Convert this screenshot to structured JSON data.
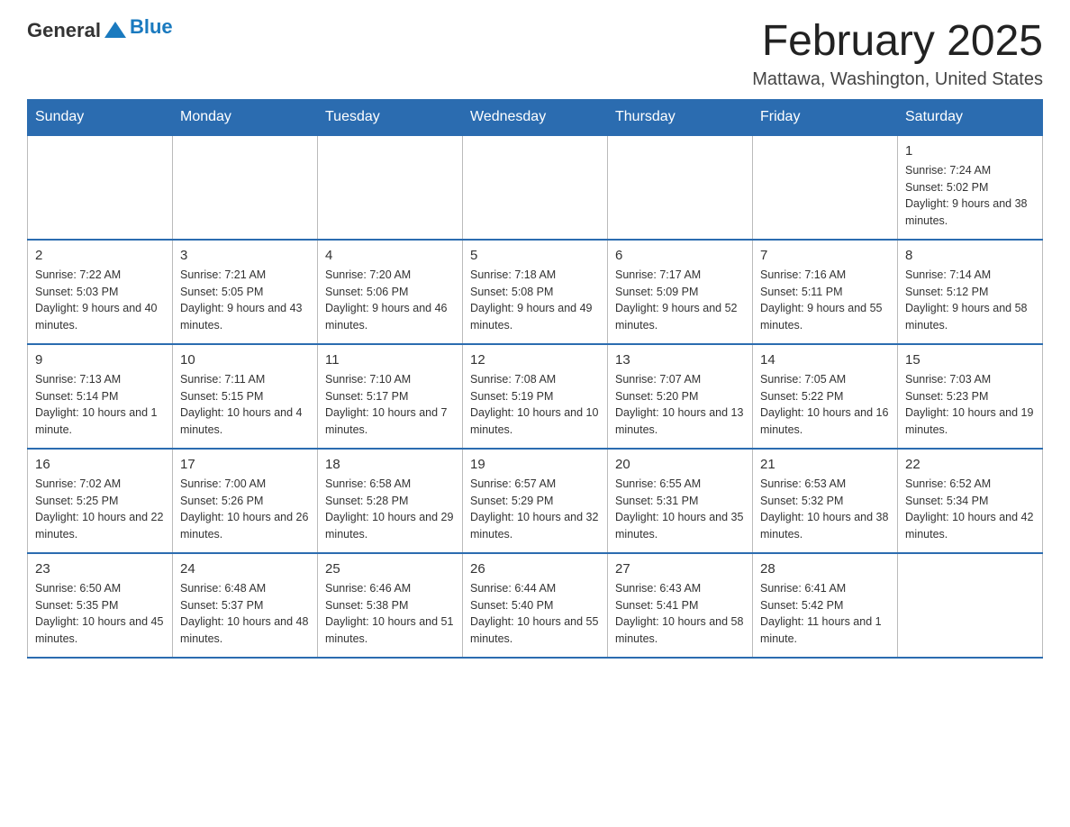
{
  "header": {
    "logo": {
      "general": "General",
      "blue": "Blue"
    },
    "title": "February 2025",
    "location": "Mattawa, Washington, United States"
  },
  "weekdays": [
    "Sunday",
    "Monday",
    "Tuesday",
    "Wednesday",
    "Thursday",
    "Friday",
    "Saturday"
  ],
  "weeks": [
    [
      {
        "day": "",
        "info": ""
      },
      {
        "day": "",
        "info": ""
      },
      {
        "day": "",
        "info": ""
      },
      {
        "day": "",
        "info": ""
      },
      {
        "day": "",
        "info": ""
      },
      {
        "day": "",
        "info": ""
      },
      {
        "day": "1",
        "info": "Sunrise: 7:24 AM\nSunset: 5:02 PM\nDaylight: 9 hours and 38 minutes."
      }
    ],
    [
      {
        "day": "2",
        "info": "Sunrise: 7:22 AM\nSunset: 5:03 PM\nDaylight: 9 hours and 40 minutes."
      },
      {
        "day": "3",
        "info": "Sunrise: 7:21 AM\nSunset: 5:05 PM\nDaylight: 9 hours and 43 minutes."
      },
      {
        "day": "4",
        "info": "Sunrise: 7:20 AM\nSunset: 5:06 PM\nDaylight: 9 hours and 46 minutes."
      },
      {
        "day": "5",
        "info": "Sunrise: 7:18 AM\nSunset: 5:08 PM\nDaylight: 9 hours and 49 minutes."
      },
      {
        "day": "6",
        "info": "Sunrise: 7:17 AM\nSunset: 5:09 PM\nDaylight: 9 hours and 52 minutes."
      },
      {
        "day": "7",
        "info": "Sunrise: 7:16 AM\nSunset: 5:11 PM\nDaylight: 9 hours and 55 minutes."
      },
      {
        "day": "8",
        "info": "Sunrise: 7:14 AM\nSunset: 5:12 PM\nDaylight: 9 hours and 58 minutes."
      }
    ],
    [
      {
        "day": "9",
        "info": "Sunrise: 7:13 AM\nSunset: 5:14 PM\nDaylight: 10 hours and 1 minute."
      },
      {
        "day": "10",
        "info": "Sunrise: 7:11 AM\nSunset: 5:15 PM\nDaylight: 10 hours and 4 minutes."
      },
      {
        "day": "11",
        "info": "Sunrise: 7:10 AM\nSunset: 5:17 PM\nDaylight: 10 hours and 7 minutes."
      },
      {
        "day": "12",
        "info": "Sunrise: 7:08 AM\nSunset: 5:19 PM\nDaylight: 10 hours and 10 minutes."
      },
      {
        "day": "13",
        "info": "Sunrise: 7:07 AM\nSunset: 5:20 PM\nDaylight: 10 hours and 13 minutes."
      },
      {
        "day": "14",
        "info": "Sunrise: 7:05 AM\nSunset: 5:22 PM\nDaylight: 10 hours and 16 minutes."
      },
      {
        "day": "15",
        "info": "Sunrise: 7:03 AM\nSunset: 5:23 PM\nDaylight: 10 hours and 19 minutes."
      }
    ],
    [
      {
        "day": "16",
        "info": "Sunrise: 7:02 AM\nSunset: 5:25 PM\nDaylight: 10 hours and 22 minutes."
      },
      {
        "day": "17",
        "info": "Sunrise: 7:00 AM\nSunset: 5:26 PM\nDaylight: 10 hours and 26 minutes."
      },
      {
        "day": "18",
        "info": "Sunrise: 6:58 AM\nSunset: 5:28 PM\nDaylight: 10 hours and 29 minutes."
      },
      {
        "day": "19",
        "info": "Sunrise: 6:57 AM\nSunset: 5:29 PM\nDaylight: 10 hours and 32 minutes."
      },
      {
        "day": "20",
        "info": "Sunrise: 6:55 AM\nSunset: 5:31 PM\nDaylight: 10 hours and 35 minutes."
      },
      {
        "day": "21",
        "info": "Sunrise: 6:53 AM\nSunset: 5:32 PM\nDaylight: 10 hours and 38 minutes."
      },
      {
        "day": "22",
        "info": "Sunrise: 6:52 AM\nSunset: 5:34 PM\nDaylight: 10 hours and 42 minutes."
      }
    ],
    [
      {
        "day": "23",
        "info": "Sunrise: 6:50 AM\nSunset: 5:35 PM\nDaylight: 10 hours and 45 minutes."
      },
      {
        "day": "24",
        "info": "Sunrise: 6:48 AM\nSunset: 5:37 PM\nDaylight: 10 hours and 48 minutes."
      },
      {
        "day": "25",
        "info": "Sunrise: 6:46 AM\nSunset: 5:38 PM\nDaylight: 10 hours and 51 minutes."
      },
      {
        "day": "26",
        "info": "Sunrise: 6:44 AM\nSunset: 5:40 PM\nDaylight: 10 hours and 55 minutes."
      },
      {
        "day": "27",
        "info": "Sunrise: 6:43 AM\nSunset: 5:41 PM\nDaylight: 10 hours and 58 minutes."
      },
      {
        "day": "28",
        "info": "Sunrise: 6:41 AM\nSunset: 5:42 PM\nDaylight: 11 hours and 1 minute."
      },
      {
        "day": "",
        "info": ""
      }
    ]
  ]
}
